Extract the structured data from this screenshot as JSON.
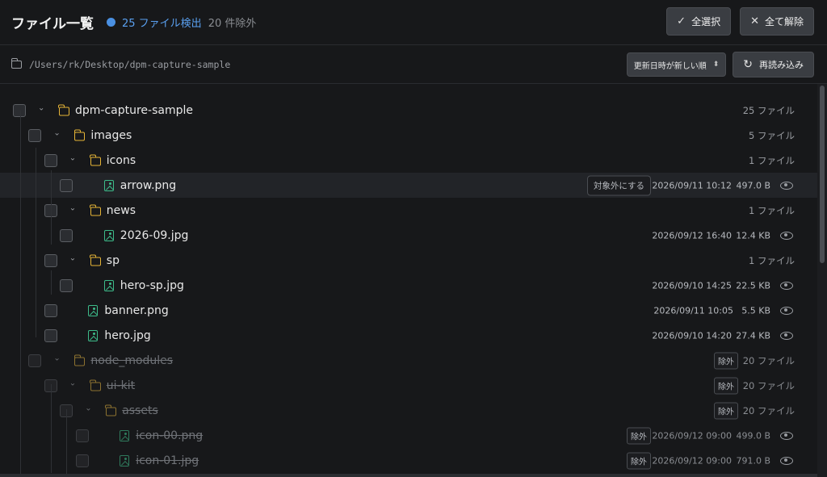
{
  "header": {
    "title": "ファイル一覧",
    "found": "25 ファイル検出",
    "excluded": "20 件除外",
    "select_all": "全選択",
    "deselect_all": "全て解除"
  },
  "pathbar": {
    "path": "/Users/rk/Desktop/dpm-capture-sample",
    "sort": "更新日時が新しい順",
    "reload": "再読み込み"
  },
  "colors": {
    "accent": "#4a90e2",
    "folder": "#e5b437",
    "image": "#3dbb8a"
  },
  "tree": [
    {
      "name": "dpm-capture-sample",
      "kind": "folder",
      "depth": 0,
      "count": "25 ファイル"
    },
    {
      "name": "images",
      "kind": "folder",
      "depth": 1,
      "count": "5 ファイル"
    },
    {
      "name": "icons",
      "kind": "folder",
      "depth": 2,
      "count": "1 ファイル"
    },
    {
      "name": "arrow.png",
      "kind": "file",
      "depth": 3,
      "date": "2026/09/11 10:12",
      "size": "497.0 B",
      "action": "対象外にする",
      "highlight": true
    },
    {
      "name": "news",
      "kind": "folder",
      "depth": 2,
      "count": "1 ファイル"
    },
    {
      "name": "2026-09.jpg",
      "kind": "file",
      "depth": 3,
      "date": "2026/09/12 16:40",
      "size": "12.4 KB"
    },
    {
      "name": "sp",
      "kind": "folder",
      "depth": 2,
      "count": "1 ファイル"
    },
    {
      "name": "hero-sp.jpg",
      "kind": "file",
      "depth": 3,
      "date": "2026/09/10 14:25",
      "size": "22.5 KB"
    },
    {
      "name": "banner.png",
      "kind": "file",
      "depth": 2,
      "date": "2026/09/11 10:05",
      "size": "5.5 KB"
    },
    {
      "name": "hero.jpg",
      "kind": "file",
      "depth": 2,
      "date": "2026/09/10 14:20",
      "size": "27.4 KB"
    },
    {
      "name": "node_modules",
      "kind": "folder",
      "depth": 1,
      "count": "20 ファイル",
      "excluded": true,
      "badge": "除外"
    },
    {
      "name": "ui-kit",
      "kind": "folder",
      "depth": 2,
      "count": "20 ファイル",
      "excluded": true,
      "badge": "除外"
    },
    {
      "name": "assets",
      "kind": "folder",
      "depth": 3,
      "count": "20 ファイル",
      "excluded": true,
      "badge": "除外"
    },
    {
      "name": "icon-00.png",
      "kind": "file",
      "depth": 4,
      "date": "2026/09/12 09:00",
      "size": "499.0 B",
      "excluded": true,
      "badge": "除外"
    },
    {
      "name": "icon-01.jpg",
      "kind": "file",
      "depth": 4,
      "date": "2026/09/12 09:00",
      "size": "791.0 B",
      "excluded": true,
      "badge": "除外"
    }
  ]
}
